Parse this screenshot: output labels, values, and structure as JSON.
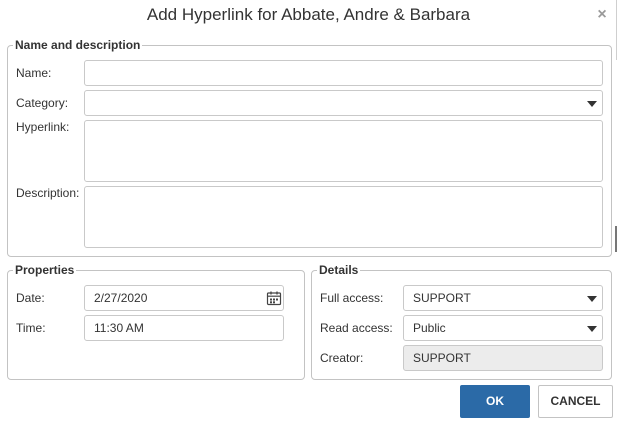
{
  "dialog": {
    "title": "Add Hyperlink for Abbate, Andre & Barbara",
    "close_glyph": "×"
  },
  "name_description": {
    "legend": "Name and description",
    "name_label": "Name:",
    "name_value": "",
    "category_label": "Category:",
    "category_value": "",
    "hyperlink_label": "Hyperlink:",
    "hyperlink_value": "",
    "description_label": "Description:",
    "description_value": ""
  },
  "properties": {
    "legend": "Properties",
    "date_label": "Date:",
    "date_value": "2/27/2020",
    "time_label": "Time:",
    "time_value": "11:30 AM"
  },
  "details": {
    "legend": "Details",
    "full_access_label": "Full access:",
    "full_access_value": "SUPPORT",
    "read_access_label": "Read access:",
    "read_access_value": "Public",
    "creator_label": "Creator:",
    "creator_value": "SUPPORT"
  },
  "buttons": {
    "ok": "OK",
    "cancel": "CANCEL"
  },
  "icons": {
    "close": "close-icon",
    "dropdown": "chevron-down-icon",
    "calendar": "calendar-icon"
  },
  "colors": {
    "primary_button": "#2b6aa7",
    "border": "#c3c3c3",
    "readonly_field": "#ececec"
  }
}
